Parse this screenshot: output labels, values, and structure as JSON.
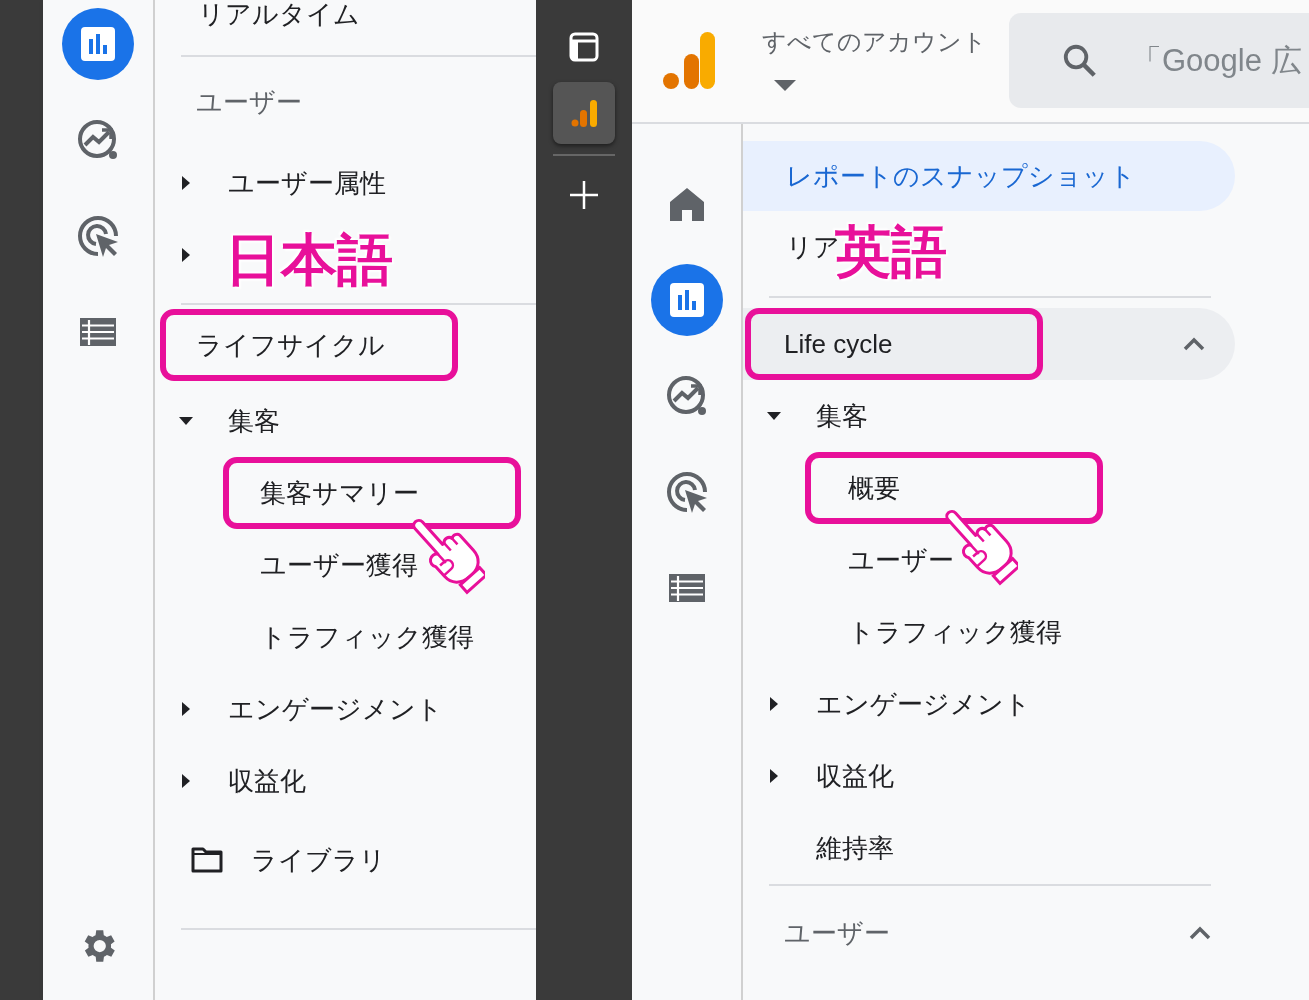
{
  "left": {
    "rail": [
      {
        "kind": "reports",
        "selected": true
      },
      {
        "kind": "explore",
        "selected": false
      },
      {
        "kind": "advertising",
        "selected": false
      },
      {
        "kind": "list",
        "selected": false
      },
      {
        "kind": "settings",
        "selected": false
      }
    ],
    "nav": [
      {
        "kind": "item",
        "label": "リアルタイム"
      },
      {
        "kind": "divider"
      },
      {
        "kind": "section",
        "label": "ユーザー",
        "highlighted": false
      },
      {
        "kind": "group",
        "label": "ユーザー属性",
        "expanded": false
      },
      {
        "kind": "group",
        "expanded": false,
        "overlay_label": "日本語"
      },
      {
        "kind": "divider"
      },
      {
        "kind": "section",
        "label": "ライフサイクル",
        "highlighted": true
      },
      {
        "kind": "group",
        "label": "集客",
        "expanded": true,
        "children": [
          {
            "label": "集客サマリー",
            "highlighted": true,
            "pointer": true
          },
          {
            "label": "ユーザー獲得",
            "highlighted": false,
            "pointer": false
          },
          {
            "label": "トラフィック獲得",
            "highlighted": false,
            "pointer": false
          }
        ]
      },
      {
        "kind": "group",
        "label": "エンゲージメント",
        "expanded": false
      },
      {
        "kind": "group",
        "label": "収益化",
        "expanded": false
      },
      {
        "kind": "library",
        "label": "ライブラリ"
      },
      {
        "kind": "divider"
      }
    ]
  },
  "switcher": [
    {
      "kind": "window",
      "selected": false
    },
    {
      "kind": "analytics",
      "selected": true
    },
    {
      "kind": "add",
      "selected": false
    }
  ],
  "right": {
    "header": {
      "account": "すべてのアカウント",
      "search_placeholder": "「Google 広"
    },
    "rail": [
      {
        "kind": "home",
        "selected": false
      },
      {
        "kind": "reports",
        "selected": true
      },
      {
        "kind": "explore",
        "selected": false
      },
      {
        "kind": "advertising",
        "selected": false
      },
      {
        "kind": "list",
        "selected": false
      }
    ],
    "nav": [
      {
        "kind": "item",
        "label": "レポートのスナップショット",
        "selected": true
      },
      {
        "kind": "item",
        "label": "リア",
        "selected": false,
        "overlay_label": "英語"
      },
      {
        "kind": "divider"
      },
      {
        "kind": "section",
        "label": "Life cycle",
        "highlighted": true,
        "expanded": true,
        "hovered": true
      },
      {
        "kind": "group",
        "label": "集客",
        "expanded": true,
        "children": [
          {
            "label": "概要",
            "highlighted": true,
            "pointer": true
          },
          {
            "label": "ユーザー",
            "highlighted": false,
            "pointer": false
          },
          {
            "label": "トラフィック獲得",
            "highlighted": false,
            "pointer": false
          }
        ]
      },
      {
        "kind": "group",
        "label": "エンゲージメント",
        "expanded": false
      },
      {
        "kind": "group",
        "label": "収益化",
        "expanded": false
      },
      {
        "kind": "item",
        "label": "維持率",
        "selected": false,
        "indent": true
      },
      {
        "kind": "divider"
      },
      {
        "kind": "section",
        "label": "ユーザー",
        "highlighted": false,
        "expanded": true,
        "hovered": false
      }
    ]
  }
}
